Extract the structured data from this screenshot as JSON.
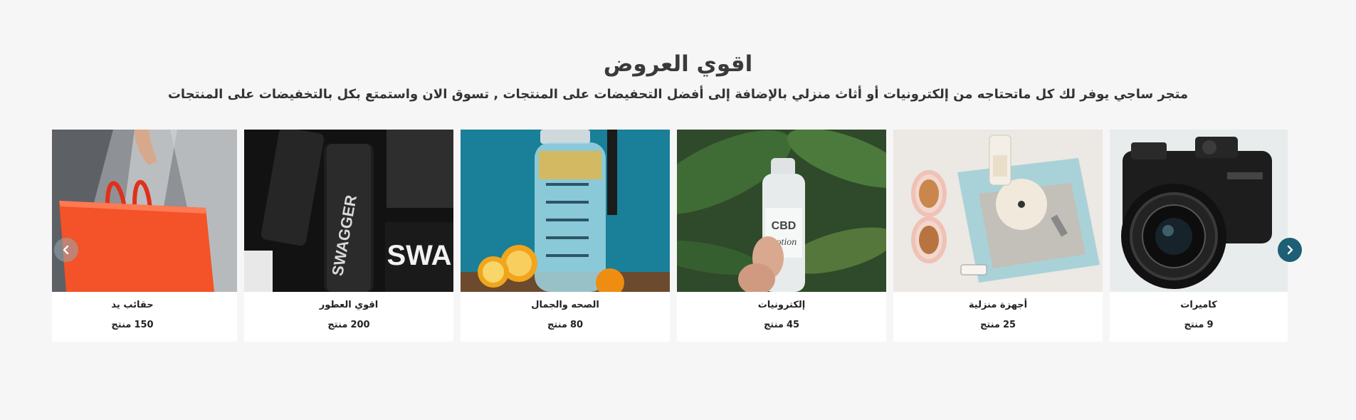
{
  "section": {
    "title": "اقوي العروض",
    "subtitle": "متجر ساجي يوفر لك كل ماتحتاجه من إلكترونيات أو أثاث منزلي بالإضافة إلى أفضل التحفيضات على المنتجات , تسوق الان واستمتع بكل بالتخفيضات على المنتجات"
  },
  "categories": [
    {
      "name": "كاميرات",
      "count": "9",
      "unit": "منتج",
      "image": "camera-image"
    },
    {
      "name": "أجهزة منزلية",
      "count": "25",
      "unit": "منتج",
      "image": "sunglasses-flatlay-image"
    },
    {
      "name": "إلكترونيات",
      "count": "45",
      "unit": "منتج",
      "image": "cbd-lotion-image"
    },
    {
      "name": "الصحه والجمال",
      "count": "80",
      "unit": "منتج",
      "image": "water-bottle-image"
    },
    {
      "name": "اقوي العطور",
      "count": "200",
      "unit": "منتج",
      "image": "perfume-bottles-image"
    },
    {
      "name": "حقائب يد",
      "count": "150",
      "unit": "منتج",
      "image": "shopping-bag-image"
    }
  ],
  "navigation": {
    "next_icon": "chevron-right-icon",
    "prev_icon": "chevron-left-icon"
  },
  "colors": {
    "background": "#f6f6f6",
    "card": "#ffffff",
    "nav_active": "#1d5f74"
  }
}
